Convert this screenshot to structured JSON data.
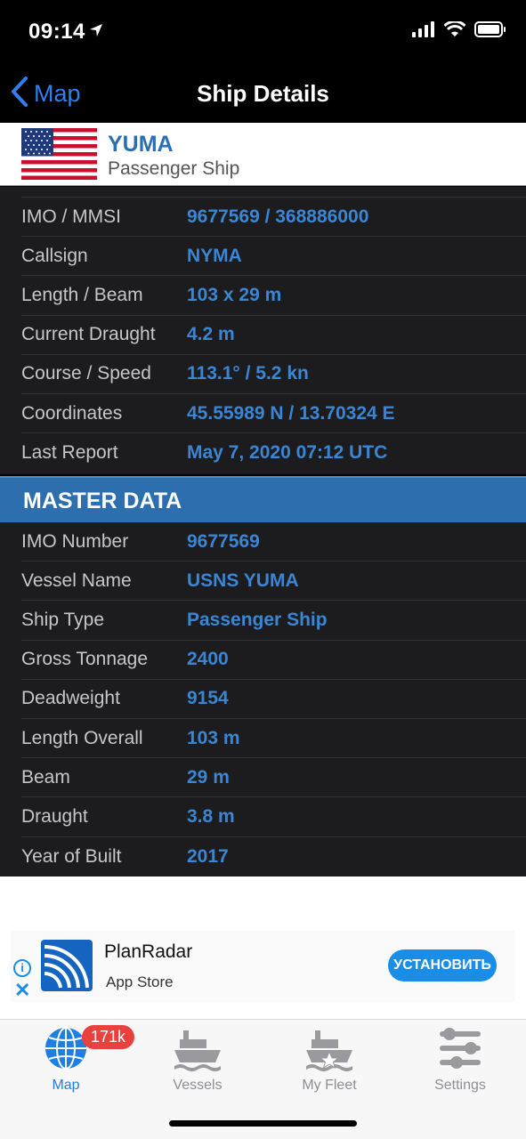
{
  "status": {
    "time": "09:14"
  },
  "nav": {
    "back_label": "Map",
    "title": "Ship Details"
  },
  "ship": {
    "name": "YUMA",
    "type": "Passenger Ship"
  },
  "details": [
    {
      "label": "IMO / MMSI",
      "value": "9677569 / 368886000"
    },
    {
      "label": "Callsign",
      "value": "NYMA"
    },
    {
      "label": "Length / Beam",
      "value": "103 x 29 m"
    },
    {
      "label": "Current Draught",
      "value": "4.2 m"
    },
    {
      "label": "Course / Speed",
      "value": "113.1° / 5.2 kn"
    },
    {
      "label": "Coordinates",
      "value": "45.55989 N / 13.70324 E"
    },
    {
      "label": "Last Report",
      "value": "May 7, 2020 07:12 UTC"
    }
  ],
  "master": {
    "title": "MASTER DATA",
    "rows": [
      {
        "label": "IMO Number",
        "value": "9677569"
      },
      {
        "label": "Vessel Name",
        "value": "USNS YUMA"
      },
      {
        "label": "Ship Type",
        "value": "Passenger Ship"
      },
      {
        "label": "Gross Tonnage",
        "value": "2400"
      },
      {
        "label": "Deadweight",
        "value": "9154"
      },
      {
        "label": "Length Overall",
        "value": "103 m"
      },
      {
        "label": "Beam",
        "value": "29 m"
      },
      {
        "label": "Draught",
        "value": "3.8 m"
      },
      {
        "label": "Year of Built",
        "value": "2017"
      }
    ]
  },
  "ad": {
    "title": "PlanRadar",
    "subtitle": "App Store",
    "install_label": "УСТАНОВИТЬ"
  },
  "tabs": [
    {
      "label": "Map",
      "icon": "globe-icon"
    },
    {
      "label": "Vessels",
      "icon": "ship-icon"
    },
    {
      "label": "My Fleet",
      "icon": "fleet-star-icon"
    },
    {
      "label": "Settings",
      "icon": "sliders-icon"
    }
  ],
  "badge": "171k",
  "colors": {
    "accent": "#2f7ff0",
    "section_header": "#2c6eae",
    "value_text": "#3a86d4",
    "badge": "#e9413e"
  }
}
